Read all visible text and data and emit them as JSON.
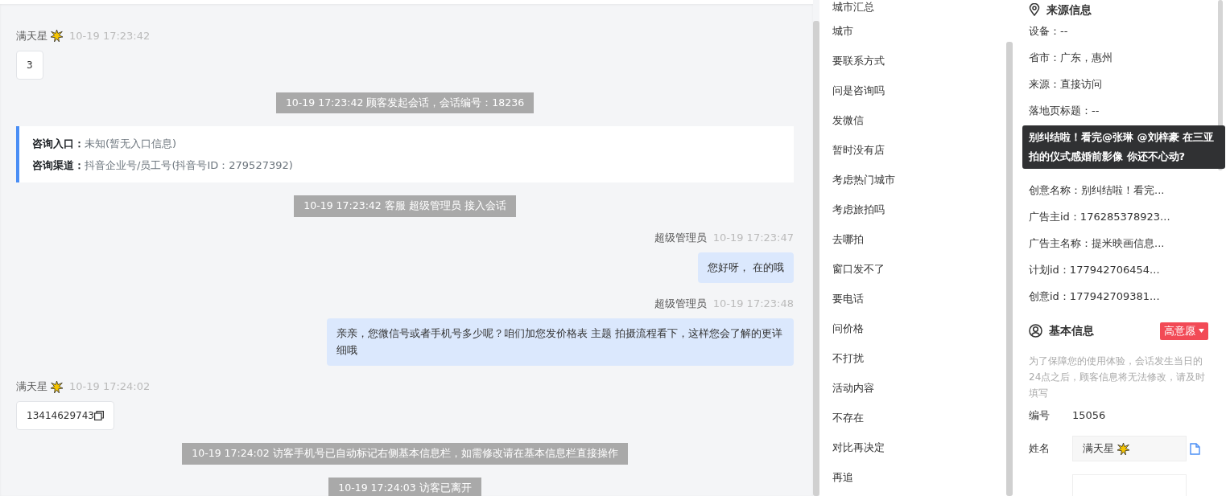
{
  "chat": [
    {
      "kind": "visitor",
      "name": "满天星",
      "time": "10-19 17:23:42",
      "text": "3",
      "copyable": false
    },
    {
      "kind": "system",
      "text": "10-19 17:23:42 顾客发起会话，会话编号：18236"
    },
    {
      "kind": "info",
      "lines": [
        {
          "label": "咨询入口：",
          "value": "未知(暂无入口信息)"
        },
        {
          "label": "咨询渠道：",
          "value": "抖音企业号/员工号(抖音号ID：279527392)"
        }
      ]
    },
    {
      "kind": "system",
      "text": "10-19 17:23:42 客服 超级管理员 接入会话"
    },
    {
      "kind": "agent",
      "name": "超级管理员",
      "time": "10-19 17:23:47",
      "text": "您好呀， 在的哦"
    },
    {
      "kind": "agent",
      "name": "超级管理员",
      "time": "10-19 17:23:48",
      "text": "亲亲，您微信号或者手机号多少呢？咱们加您发价格表 主题 拍摄流程看下，这样您会了解的更详细哦"
    },
    {
      "kind": "visitor",
      "name": "满天星",
      "time": "10-19 17:24:02",
      "text": "13414629743",
      "copyable": true
    },
    {
      "kind": "system",
      "text": "10-19 17:24:02 访客手机号已自动标记右侧基本信息栏，如需修改请在基本信息栏直接操作"
    },
    {
      "kind": "system",
      "text": "10-19 17:24:03 访客已离开"
    }
  ],
  "quick_replies": [
    "城市汇总",
    "城市",
    "要联系方式",
    "问是咨询吗",
    "发微信",
    "暂时没有店",
    "考虑热门城市",
    "考虑旅拍吗",
    "去哪拍",
    "窗口发不了",
    "要电话",
    "问价格",
    "不打扰",
    "活动内容",
    "不存在",
    "对比再决定",
    "再追"
  ],
  "source_info": {
    "title": "来源信息",
    "fields_above": [
      "设备：--",
      "省市：广东，惠州",
      "来源：直接访问",
      "落地页标题：--"
    ],
    "fields_below": [
      "创意名称：别纠结啦！看完...",
      "广告主id：176285378923...",
      "广告主名称：提米映画信息...",
      "计划id：177942706454...",
      "创意id：177942709381..."
    ],
    "tooltip": "别纠结啦！看完@张琳 @刘梓豪 在三亚拍的仪式感婚前影像 你还不心动?"
  },
  "basic_info": {
    "title": "基本信息",
    "intent_tag": "高意愿",
    "note": "为了保障您的使用体验，会话发生当日的24点之后，顾客信息将无法修改，请及时填写",
    "fields": [
      {
        "kind": "text",
        "label": "编号",
        "value": "15056"
      },
      {
        "kind": "input",
        "label": "姓名",
        "value": "满天星"
      },
      {
        "kind": "input"
      }
    ]
  }
}
